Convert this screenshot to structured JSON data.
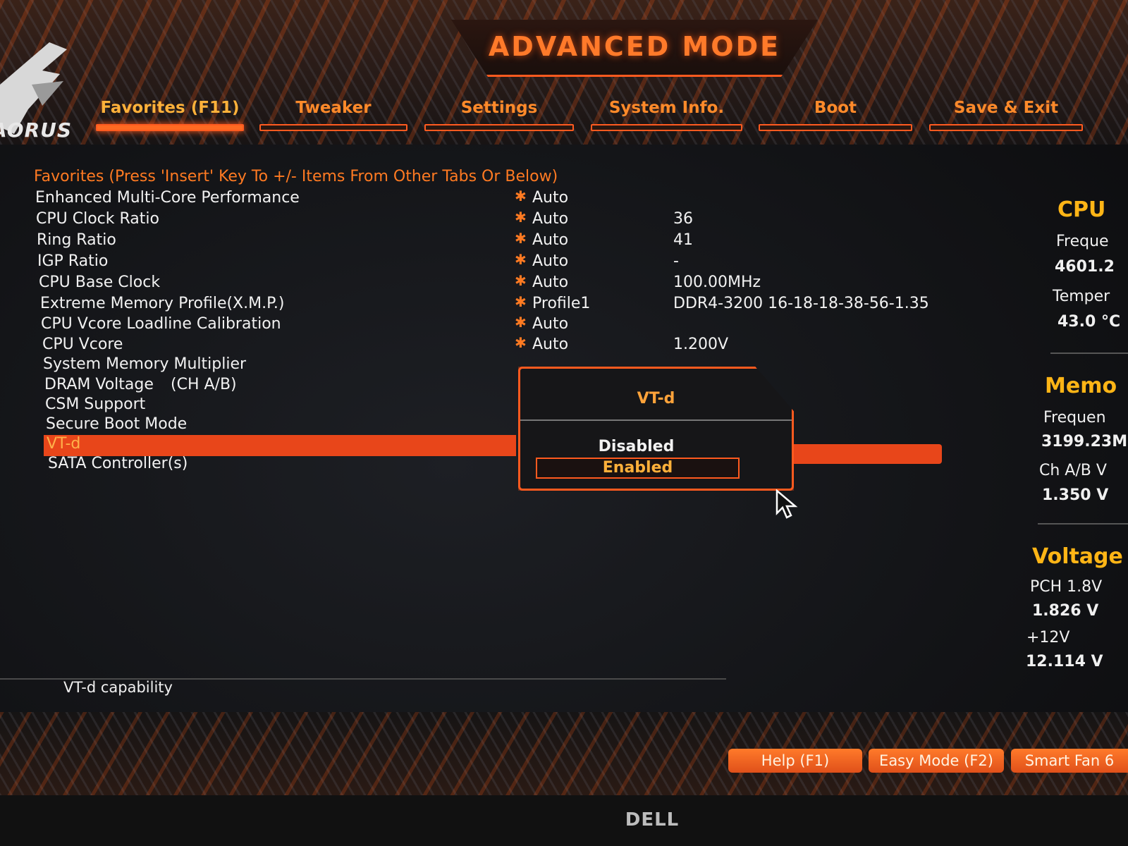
{
  "header": {
    "title": "ADVANCED MODE",
    "logo_text": "AORUS"
  },
  "tabs": [
    {
      "label": "Favorites (F11)",
      "active": true
    },
    {
      "label": "Tweaker"
    },
    {
      "label": "Settings"
    },
    {
      "label": "System Info."
    },
    {
      "label": "Boot"
    },
    {
      "label": "Save & Exit"
    }
  ],
  "favorites": {
    "header": "Favorites (Press 'Insert' Key To +/- Items From Other Tabs Or Below)",
    "items": [
      {
        "name": "Enhanced Multi-Core Performance",
        "value": "Auto",
        "current": ""
      },
      {
        "name": "CPU Clock Ratio",
        "value": "Auto",
        "current": "36"
      },
      {
        "name": "Ring Ratio",
        "value": "Auto",
        "current": "41"
      },
      {
        "name": "IGP Ratio",
        "value": "Auto",
        "current": "-"
      },
      {
        "name": "CPU Base Clock",
        "value": "Auto",
        "current": "100.00MHz"
      },
      {
        "name": "Extreme Memory Profile(X.M.P.)",
        "value": "Profile1",
        "current": "DDR4-3200 16-18-18-38-56-1.35"
      },
      {
        "name": "CPU Vcore Loadline Calibration",
        "value": "Auto",
        "current": ""
      },
      {
        "name": "CPU Vcore",
        "value": "Auto",
        "current": "1.200V"
      },
      {
        "name": "System Memory Multiplier",
        "value": "",
        "current": ""
      },
      {
        "name": "DRAM Voltage",
        "name_suffix": "(CH A/B)",
        "value": "",
        "current": ""
      },
      {
        "name": "CSM Support",
        "value": "",
        "current": ""
      },
      {
        "name": "Secure Boot Mode",
        "value": "",
        "current": ""
      },
      {
        "name": "VT-d",
        "value": "",
        "current": "",
        "selected": true
      },
      {
        "name": "SATA Controller(s)",
        "value": "",
        "current": ""
      }
    ]
  },
  "popup": {
    "title": "VT-d",
    "options": [
      "Disabled",
      "Enabled"
    ],
    "highlighted": "Enabled"
  },
  "sidebar": {
    "cpu": {
      "heading": "CPU",
      "freq_label": "Freque",
      "freq_value": "4601.2",
      "temp_label": "Temper",
      "temp_value": "43.0 °C"
    },
    "memory": {
      "heading": "Memo",
      "freq_label": "Frequen",
      "freq_value": "3199.23M",
      "volt_label": "Ch A/B V",
      "volt_value": "1.350 V"
    },
    "voltage": {
      "heading": "Voltage",
      "pch_label": "PCH 1.8V",
      "pch_value": "1.826 V",
      "v12_label": "+12V",
      "v12_value": "12.114 V"
    }
  },
  "help": {
    "text": "VT-d capability"
  },
  "footer": {
    "buttons": [
      "Help (F1)",
      "Easy Mode (F2)",
      "Smart Fan 6"
    ]
  },
  "monitor": {
    "brand": "DELL"
  },
  "colors": {
    "accent": "#ff5a1f",
    "highlight": "#e8461a",
    "heading_yellow": "#ffb516"
  }
}
